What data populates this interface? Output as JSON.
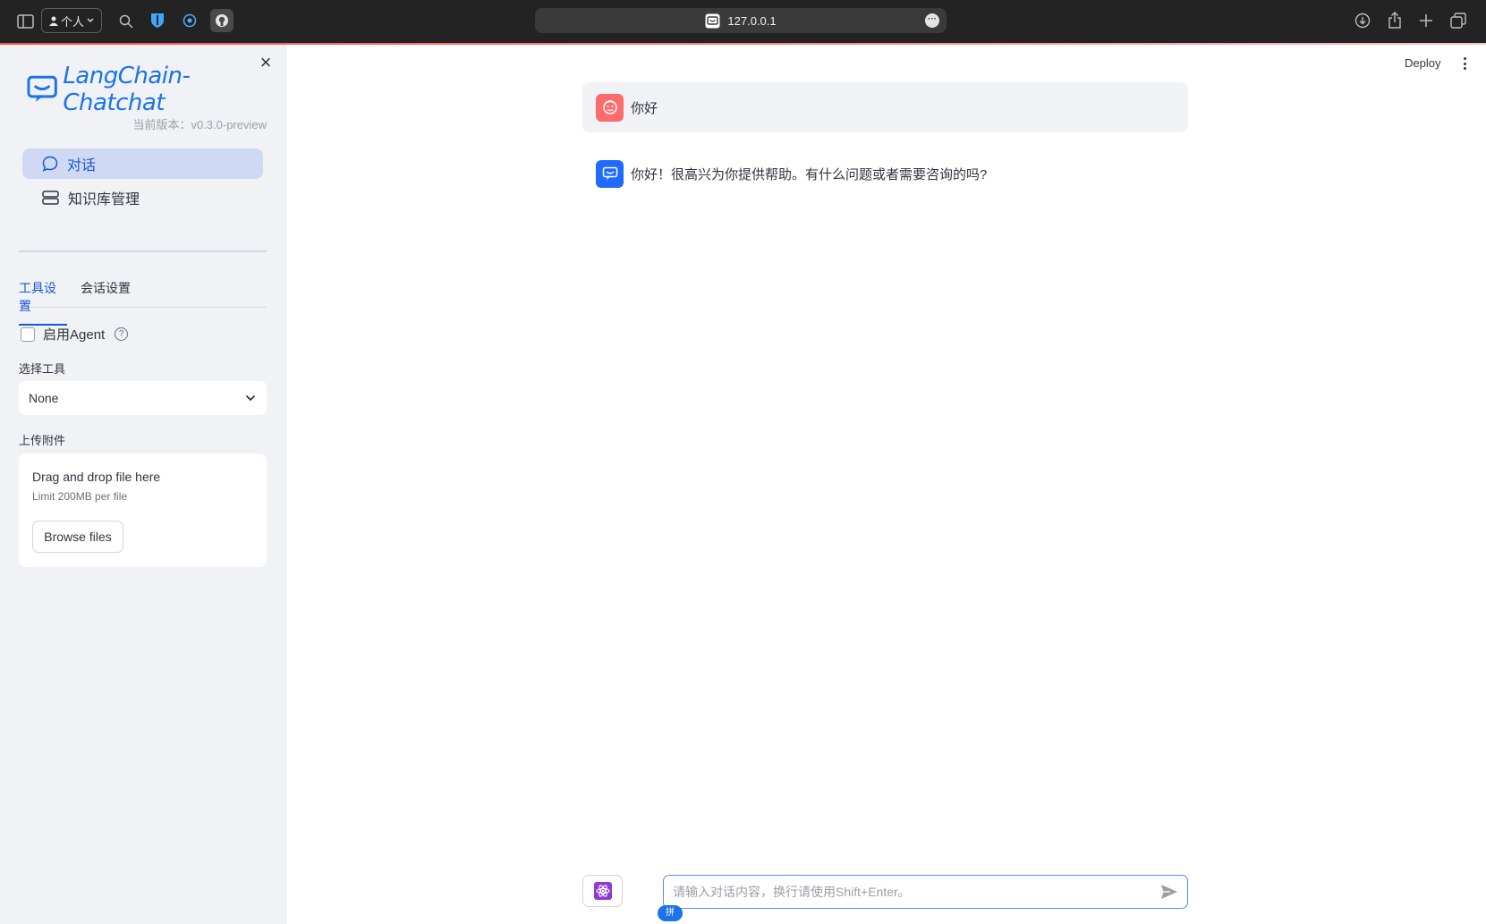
{
  "browser": {
    "profile_label": "个人",
    "url": "127.0.0.1"
  },
  "sidebar": {
    "logo_text": "LangChain-Chatchat",
    "version": "当前版本：v0.3.0-preview",
    "nav": [
      {
        "label": "对话",
        "active": true
      },
      {
        "label": "知识库管理",
        "active": false
      }
    ],
    "tabs": [
      {
        "label": "工具设置",
        "active": true
      },
      {
        "label": "会话设置",
        "active": false
      }
    ],
    "agent_checkbox_label": "启用Agent",
    "agent_checked": false,
    "select_tool_label": "选择工具",
    "select_tool_value": "None",
    "upload_label": "上传附件",
    "uploader": {
      "title": "Drag and drop file here",
      "limit": "Limit 200MB per file",
      "browse_label": "Browse files"
    }
  },
  "header": {
    "deploy_label": "Deploy"
  },
  "chat": {
    "messages": [
      {
        "role": "user",
        "text": "你好"
      },
      {
        "role": "assistant",
        "text": "你好！很高兴为你提供帮助。有什么问题或者需要咨询的吗?"
      }
    ],
    "input_placeholder": "请输入对话内容，换行请使用Shift+Enter。",
    "ime_badge": "拼"
  },
  "colors": {
    "accent": "#1a57d6",
    "sidebar_bg": "#f0f2f6",
    "user_avatar": "#ff6b6b",
    "bot_avatar": "#1f6bff"
  }
}
